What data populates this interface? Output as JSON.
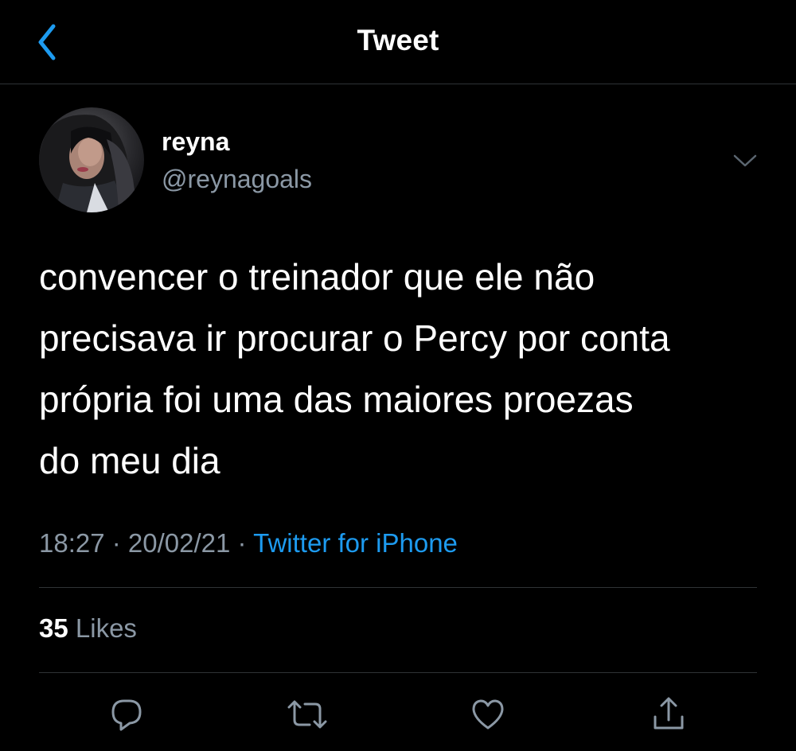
{
  "nav": {
    "title": "Tweet",
    "back_icon": "chevron-left-icon"
  },
  "tweet": {
    "author": {
      "display_name": "reyna",
      "handle": "@reynagoals"
    },
    "text_lines": [
      "convencer o treinador que ele não",
      "precisava ir procurar o Percy por conta",
      "própria foi uma das maiores proezas",
      "do meu dia"
    ],
    "time": "18:27",
    "separator": " · ",
    "date": "20/02/21",
    "source": "Twitter for iPhone",
    "likes_count": "35",
    "likes_label": " Likes"
  },
  "actions": {
    "icons": [
      "reply-icon",
      "retweet-icon",
      "like-icon",
      "share-icon"
    ]
  },
  "colors": {
    "background": "#000000",
    "text_primary": "#ffffff",
    "text_secondary": "#8b98a5",
    "accent": "#1d9bf0",
    "divider": "#2f3336"
  }
}
